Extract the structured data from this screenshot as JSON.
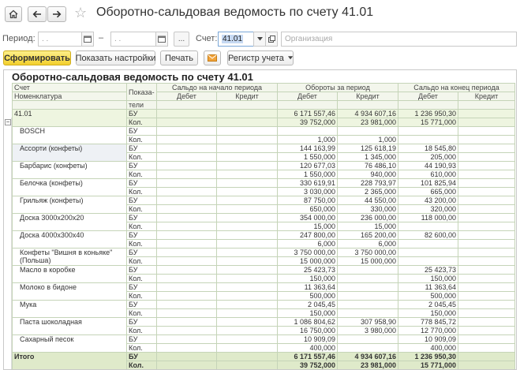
{
  "window": {
    "title": "Оборотно-сальдовая ведомость по счету 41.01"
  },
  "period": {
    "label": "Период:",
    "from": ". .",
    "separator": "–",
    "to": ". .",
    "more": "...",
    "account_label": "Счет:",
    "account_value": "41.01",
    "org_placeholder": "Организация"
  },
  "toolbar": {
    "generate": "Сформировать",
    "show_settings": "Показать настройки",
    "print": "Печать",
    "register": "Регистр учета"
  },
  "report": {
    "title": "Оборотно-сальдовая ведомость по счету 41.01",
    "headers": {
      "account": "Счет",
      "nomenclature": "Номенклатура",
      "indicator_1": "Показа-",
      "indicator_2": "тели",
      "opening": "Сальдо на начало периода",
      "turnover": "Обороты за период",
      "closing": "Сальдо на конец периода",
      "debit": "Дебет",
      "credit": "Кредит"
    },
    "account_row": {
      "name": "41.01",
      "rows": [
        {
          "ind": "БУ",
          "od": "",
          "oc": "",
          "td": "6 171 557,46",
          "tc": "4 934 607,16",
          "cd": "1 236 950,30",
          "cc": ""
        },
        {
          "ind": "Кол.",
          "od": "",
          "oc": "",
          "td": "39 752,000",
          "tc": "23 981,000",
          "cd": "15 771,000",
          "cc": ""
        }
      ]
    },
    "items": [
      {
        "name": "BOSCH",
        "bu": [
          "",
          "",
          "",
          "",
          "",
          ""
        ],
        "kol": [
          "",
          "",
          "1,000",
          "1,000",
          "",
          ""
        ]
      },
      {
        "name": "Ассорти (конфеты)",
        "bu": [
          "",
          "",
          "144 163,99",
          "125 618,19",
          "18 545,80",
          ""
        ],
        "kol": [
          "",
          "",
          "1 550,000",
          "1 345,000",
          "205,000",
          ""
        ]
      },
      {
        "name": "Барбарис (конфеты)",
        "bu": [
          "",
          "",
          "120 677,03",
          "76 486,10",
          "44 190,93",
          ""
        ],
        "kol": [
          "",
          "",
          "1 550,000",
          "940,000",
          "610,000",
          ""
        ]
      },
      {
        "name": "Белочка (конфеты)",
        "bu": [
          "",
          "",
          "330 619,91",
          "228 793,97",
          "101 825,94",
          ""
        ],
        "kol": [
          "",
          "",
          "3 030,000",
          "2 365,000",
          "665,000",
          ""
        ]
      },
      {
        "name": "Грильяж (конфеты)",
        "bu": [
          "",
          "",
          "87 750,00",
          "44 550,00",
          "43 200,00",
          ""
        ],
        "kol": [
          "",
          "",
          "650,000",
          "330,000",
          "320,000",
          ""
        ]
      },
      {
        "name": "Доска 3000х200х20",
        "bu": [
          "",
          "",
          "354 000,00",
          "236 000,00",
          "118 000,00",
          ""
        ],
        "kol": [
          "",
          "",
          "15,000",
          "15,000",
          "",
          ""
        ]
      },
      {
        "name": "Доска 4000х300х40",
        "bu": [
          "",
          "",
          "247 800,00",
          "165 200,00",
          "82 600,00",
          ""
        ],
        "kol": [
          "",
          "",
          "6,000",
          "6,000",
          "",
          ""
        ]
      },
      {
        "name": "Конфеты \"Вишня в коньяке\"",
        "name2": "(Польша)",
        "bu": [
          "",
          "",
          "3 750 000,00",
          "3 750 000,00",
          "",
          ""
        ],
        "kol": [
          "",
          "",
          "15 000,000",
          "15 000,000",
          "",
          ""
        ]
      },
      {
        "name": "Масло в коробке",
        "bu": [
          "",
          "",
          "25 423,73",
          "",
          "25 423,73",
          ""
        ],
        "kol": [
          "",
          "",
          "150,000",
          "",
          "150,000",
          ""
        ]
      },
      {
        "name": "Молоко в бидоне",
        "bu": [
          "",
          "",
          "11 363,64",
          "",
          "11 363,64",
          ""
        ],
        "kol": [
          "",
          "",
          "500,000",
          "",
          "500,000",
          ""
        ]
      },
      {
        "name": "Мука",
        "bu": [
          "",
          "",
          "2 045,45",
          "",
          "2 045,45",
          ""
        ],
        "kol": [
          "",
          "",
          "150,000",
          "",
          "150,000",
          ""
        ]
      },
      {
        "name": "Паста шоколадная",
        "bu": [
          "",
          "",
          "1 086 804,62",
          "307 958,90",
          "778 845,72",
          ""
        ],
        "kol": [
          "",
          "",
          "16 750,000",
          "3 980,000",
          "12 770,000",
          ""
        ]
      },
      {
        "name": "Сахарный песок",
        "bu": [
          "",
          "",
          "10 909,09",
          "",
          "10 909,09",
          ""
        ],
        "kol": [
          "",
          "",
          "400,000",
          "",
          "400,000",
          ""
        ]
      }
    ],
    "total": {
      "label": "Итого",
      "bu": [
        "",
        "",
        "6 171 557,46",
        "4 934 607,16",
        "1 236 950,30",
        ""
      ],
      "kol": [
        "",
        "",
        "39 752,000",
        "23 981,000",
        "15 771,000",
        ""
      ]
    },
    "indicators": {
      "bu": "БУ",
      "kol": "Кол."
    }
  },
  "icons": {
    "home": "home-icon",
    "back": "arrow-left-icon",
    "forward": "arrow-right-icon",
    "favorite": "star-icon",
    "calendar": "calendar-icon",
    "dropdown": "chevron-down-icon",
    "open": "open-icon",
    "mail": "envelope-icon"
  },
  "colors": {
    "primary_button": "#f3cf2d",
    "grid_header": "#f3f6ec",
    "account_row": "#eef5e0",
    "total_row": "#dfeaca"
  }
}
